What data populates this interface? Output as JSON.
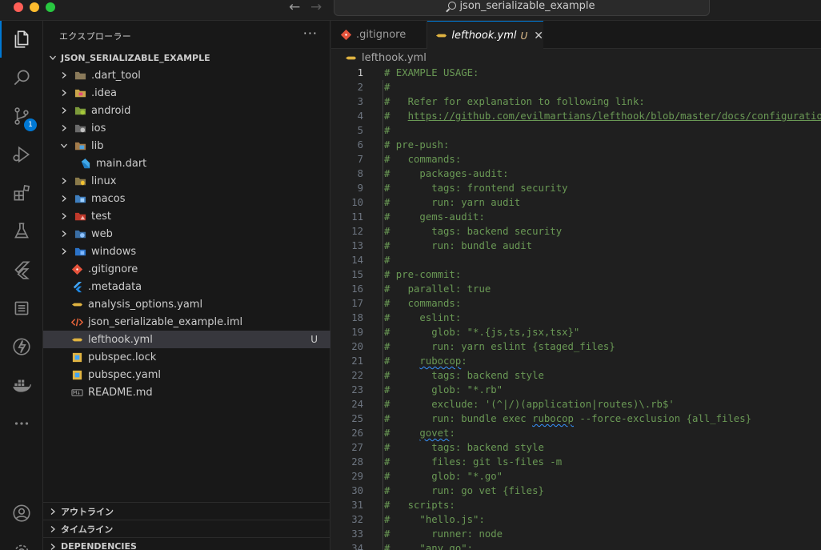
{
  "window": {
    "search_label": "json_serializable_example"
  },
  "activity_bar": {
    "source_control_badge": "1"
  },
  "sidebar": {
    "title": "エクスプローラー",
    "more_actions": "···",
    "root_label": "JSON_SERIALIZABLE_EXAMPLE",
    "items": [
      {
        "label": ".dart_tool"
      },
      {
        "label": ".idea"
      },
      {
        "label": "android"
      },
      {
        "label": "ios"
      },
      {
        "label": "lib"
      },
      {
        "label": "main.dart"
      },
      {
        "label": "linux"
      },
      {
        "label": "macos"
      },
      {
        "label": "test"
      },
      {
        "label": "web"
      },
      {
        "label": "windows"
      },
      {
        "label": ".gitignore"
      },
      {
        "label": ".metadata"
      },
      {
        "label": "analysis_options.yaml"
      },
      {
        "label": "json_serializable_example.iml"
      },
      {
        "label": "lefthook.yml",
        "status": "U"
      },
      {
        "label": "pubspec.lock"
      },
      {
        "label": "pubspec.yaml"
      },
      {
        "label": "README.md"
      }
    ],
    "panels": [
      {
        "label": "アウトライン"
      },
      {
        "label": "タイムライン"
      },
      {
        "label": "DEPENDENCIES"
      }
    ]
  },
  "editor": {
    "tabs": [
      {
        "label": ".gitignore"
      },
      {
        "label": "lefthook.yml",
        "status": "U"
      }
    ],
    "breadcrumb": "lefthook.yml",
    "lines": [
      {
        "n": "1",
        "t": "# EXAMPLE USAGE:"
      },
      {
        "n": "2",
        "t": "#"
      },
      {
        "n": "3",
        "t": "#   Refer for explanation to following link:"
      },
      {
        "n": "4",
        "t": "#   https://github.com/evilmartians/lefthook/blob/master/docs/configuration.md"
      },
      {
        "n": "5",
        "t": "#"
      },
      {
        "n": "6",
        "t": "# pre-push:"
      },
      {
        "n": "7",
        "t": "#   commands:"
      },
      {
        "n": "8",
        "t": "#     packages-audit:"
      },
      {
        "n": "9",
        "t": "#       tags: frontend security"
      },
      {
        "n": "10",
        "t": "#       run: yarn audit"
      },
      {
        "n": "11",
        "t": "#     gems-audit:"
      },
      {
        "n": "12",
        "t": "#       tags: backend security"
      },
      {
        "n": "13",
        "t": "#       run: bundle audit"
      },
      {
        "n": "14",
        "t": "#"
      },
      {
        "n": "15",
        "t": "# pre-commit:"
      },
      {
        "n": "16",
        "t": "#   parallel: true"
      },
      {
        "n": "17",
        "t": "#   commands:"
      },
      {
        "n": "18",
        "t": "#     eslint:"
      },
      {
        "n": "19",
        "t": "#       glob: \"*.{js,ts,jsx,tsx}\""
      },
      {
        "n": "20",
        "t": "#       run: yarn eslint {staged_files}"
      },
      {
        "n": "21",
        "t": "#     rubocop:"
      },
      {
        "n": "22",
        "t": "#       tags: backend style"
      },
      {
        "n": "23",
        "t": "#       glob: \"*.rb\""
      },
      {
        "n": "24",
        "t": "#       exclude: '(^|/)(application|routes)\\.rb$'"
      },
      {
        "n": "25",
        "t": "#       run: bundle exec rubocop --force-exclusion {all_files}"
      },
      {
        "n": "26",
        "t": "#     govet:"
      },
      {
        "n": "27",
        "t": "#       tags: backend style"
      },
      {
        "n": "28",
        "t": "#       files: git ls-files -m"
      },
      {
        "n": "29",
        "t": "#       glob: \"*.go\""
      },
      {
        "n": "30",
        "t": "#       run: go vet {files}"
      },
      {
        "n": "31",
        "t": "#   scripts:"
      },
      {
        "n": "32",
        "t": "#     \"hello.js\":"
      },
      {
        "n": "33",
        "t": "#       runner: node"
      },
      {
        "n": "34",
        "t": "#     \"any.go\":"
      }
    ]
  },
  "colors": {
    "accent": "#0078d4",
    "comment": "#6a9955",
    "untracked": "#e2c08d"
  }
}
